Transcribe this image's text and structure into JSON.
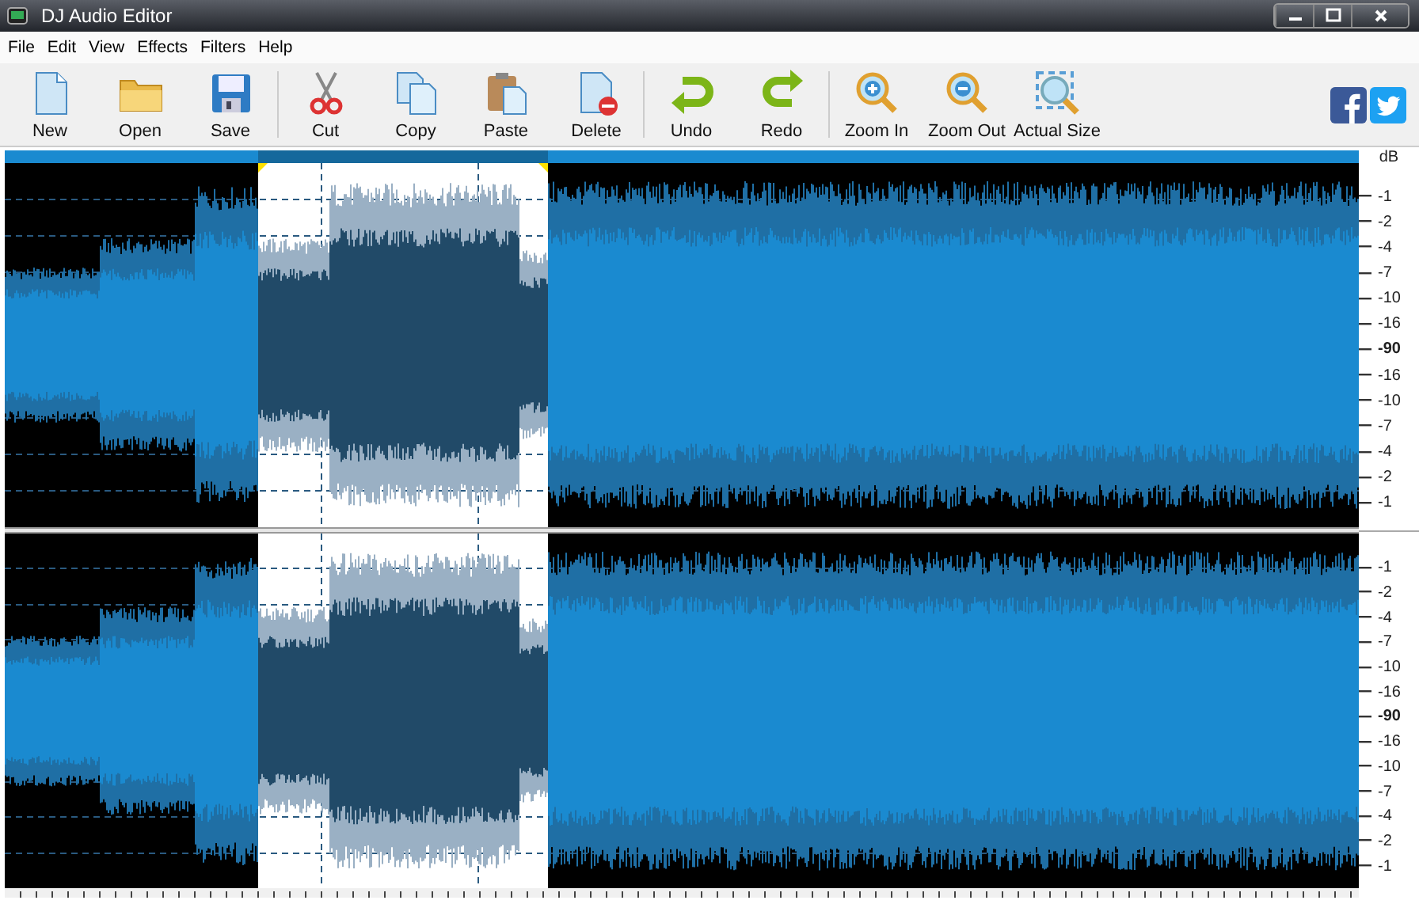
{
  "window": {
    "title": "DJ Audio Editor"
  },
  "menu": [
    "File",
    "Edit",
    "View",
    "Effects",
    "Filters",
    "Help"
  ],
  "toolbar": [
    [
      {
        "kind": "new",
        "label": "New"
      },
      {
        "kind": "open",
        "label": "Open"
      },
      {
        "kind": "save",
        "label": "Save"
      }
    ],
    [
      {
        "kind": "cut",
        "label": "Cut"
      },
      {
        "kind": "copy",
        "label": "Copy"
      },
      {
        "kind": "paste",
        "label": "Paste"
      },
      {
        "kind": "delete",
        "label": "Delete"
      }
    ],
    [
      {
        "kind": "undo",
        "label": "Undo"
      },
      {
        "kind": "redo",
        "label": "Redo"
      }
    ],
    [
      {
        "kind": "zoom-in",
        "label": "Zoom In"
      },
      {
        "kind": "zoom-out",
        "label": "Zoom Out"
      },
      {
        "kind": "actual-size",
        "label": "Actual Size"
      }
    ]
  ],
  "social": [
    {
      "kind": "facebook"
    },
    {
      "kind": "twitter"
    }
  ],
  "scale_unit": "dB",
  "channels": [
    {
      "scale": [
        {
          "text": "-1",
          "bold": false
        },
        {
          "text": "-2",
          "bold": false
        },
        {
          "text": "-4",
          "bold": false
        },
        {
          "text": "-7",
          "bold": false
        },
        {
          "text": "-10",
          "bold": false
        },
        {
          "text": "-16",
          "bold": false
        },
        {
          "text": "-90",
          "bold": true
        },
        {
          "text": "-16",
          "bold": false
        },
        {
          "text": "-10",
          "bold": false
        },
        {
          "text": "-7",
          "bold": false
        },
        {
          "text": "-4",
          "bold": false
        },
        {
          "text": "-2",
          "bold": false
        },
        {
          "text": "-1",
          "bold": false
        }
      ]
    },
    {
      "scale": [
        {
          "text": "-1",
          "bold": false
        },
        {
          "text": "-2",
          "bold": false
        },
        {
          "text": "-4",
          "bold": false
        },
        {
          "text": "-7",
          "bold": false
        },
        {
          "text": "-10",
          "bold": false
        },
        {
          "text": "-16",
          "bold": false
        },
        {
          "text": "-90",
          "bold": true
        },
        {
          "text": "-16",
          "bold": false
        },
        {
          "text": "-10",
          "bold": false
        },
        {
          "text": "-7",
          "bold": false
        },
        {
          "text": "-4",
          "bold": false
        },
        {
          "text": "-2",
          "bold": false
        },
        {
          "text": "-1",
          "bold": false
        }
      ]
    }
  ]
}
